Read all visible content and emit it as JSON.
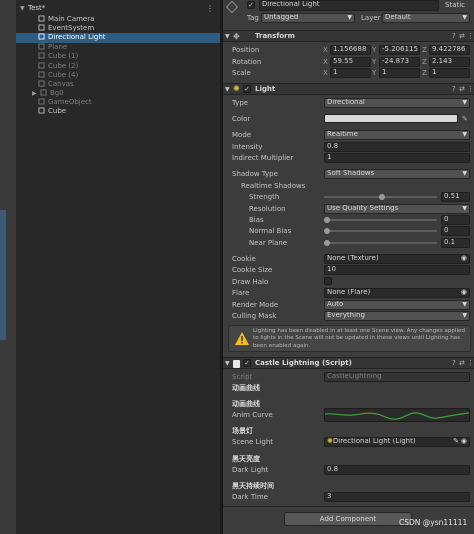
{
  "hierarchy": {
    "scene": "Test*",
    "items": [
      {
        "label": "Main Camera",
        "dim": false
      },
      {
        "label": "EventSystem",
        "dim": false
      },
      {
        "label": "Directional Light",
        "dim": false,
        "selected": true
      },
      {
        "label": "Plane",
        "dim": true
      },
      {
        "label": "Cube (1)",
        "dim": true
      },
      {
        "label": "Cube (2)",
        "dim": true
      },
      {
        "label": "Cube (4)",
        "dim": true
      },
      {
        "label": "Canvas",
        "dim": true
      },
      {
        "label": "Bg0",
        "dim": true
      },
      {
        "label": "GameObject",
        "dim": true
      },
      {
        "label": "Cube",
        "dim": false
      }
    ]
  },
  "header": {
    "name": "Directional Light",
    "static_label": "Static",
    "tag_label": "Tag",
    "tag_value": "Untagged",
    "layer_label": "Layer",
    "layer_value": "Default"
  },
  "transform": {
    "title": "Transform",
    "position_label": "Position",
    "rotation_label": "Rotation",
    "scale_label": "Scale",
    "axis_x": "X",
    "axis_y": "Y",
    "axis_z": "Z",
    "position": [
      "1.156688",
      "-5.206115",
      "9.422786"
    ],
    "rotation": [
      "59.55",
      "-24.873",
      "2.143"
    ],
    "scale": [
      "1",
      "1",
      "1"
    ]
  },
  "light": {
    "title": "Light",
    "rows": {
      "type_label": "Type",
      "type_value": "Directional",
      "color_label": "Color",
      "mode_label": "Mode",
      "mode_value": "Realtime",
      "intensity_label": "Intensity",
      "intensity_value": "0.8",
      "indirect_label": "Indirect Multiplier",
      "indirect_value": "1",
      "shadow_type_label": "Shadow Type",
      "shadow_type_value": "Soft Shadows",
      "realtime_shadows_label": "Realtime Shadows",
      "strength_label": "Strength",
      "strength_value": "0.51",
      "resolution_label": "Resolution",
      "resolution_value": "Use Quality Settings",
      "bias_label": "Bias",
      "bias_value": "0",
      "normal_bias_label": "Normal Bias",
      "normal_bias_value": "0",
      "near_plane_label": "Near Plane",
      "near_plane_value": "0.1",
      "cookie_label": "Cookie",
      "cookie_value": "None (Texture)",
      "cookie_size_label": "Cookie Size",
      "cookie_size_value": "10",
      "draw_halo_label": "Draw Halo",
      "flare_label": "Flare",
      "flare_value": "None (Flare)",
      "render_mode_label": "Render Mode",
      "render_mode_value": "Auto",
      "culling_mask_label": "Culling Mask",
      "culling_mask_value": "Everything"
    },
    "strength_fraction": 0.51,
    "near_plane_fraction": 0.0,
    "warning": "Lighting has been disabled in at least one Scene view. Any changes applied to lights in the Scene will not be updated in these views until Lighting has been enabled again.",
    "color_hex": "#d9d9d9"
  },
  "script": {
    "title": "Castle Lightning (Script)",
    "script_label": "Script",
    "script_value": "CastleLightning",
    "header1": "动画曲线",
    "header2": "动画曲线",
    "anim_curve_label": "Anim Curve",
    "header3": "场景灯",
    "scene_light_label": "Scene Light",
    "scene_light_value": "Directional Light (Light)",
    "header4": "黑天亮度",
    "dark_light_label": "Dark Light",
    "dark_light_value": "0.8",
    "header5": "黑天持续时间",
    "dark_time_label": "Dark Time",
    "dark_time_value": "3",
    "curve_color": "#3ea03e"
  },
  "footer": {
    "add_component": "Add Component",
    "watermark": "CSDN @ysn11111"
  },
  "icons": {
    "help": "?",
    "settings": "⇄",
    "more": "⋮",
    "expand": "▼",
    "dropdown": "▼",
    "target": "◉",
    "eyedropper": "✎"
  }
}
